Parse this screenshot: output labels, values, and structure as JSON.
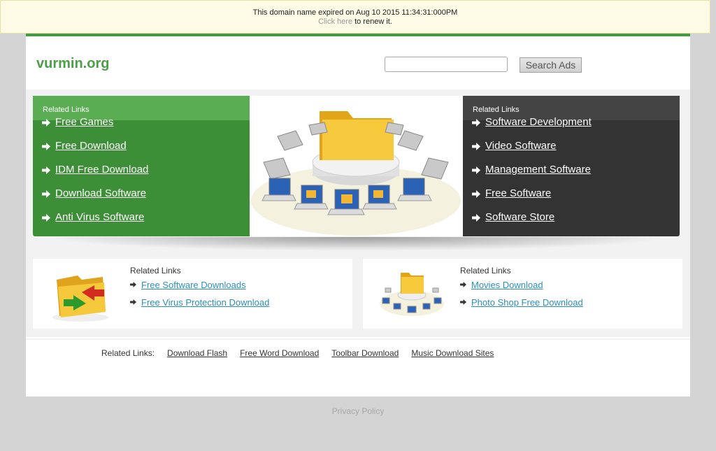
{
  "expiry": {
    "message": "This domain name expired on Aug 10 2015 11:34:31:000PM",
    "renew_link": "Click here",
    "renew_suffix": " to renew it."
  },
  "header": {
    "logo": "vurmin.org",
    "search_button": "Search Ads"
  },
  "panel_left": {
    "heading": "Related Links",
    "links": [
      "Free Games",
      "Free Download",
      "IDM Free Download",
      "Download Software",
      "Anti Virus Software"
    ]
  },
  "panel_right": {
    "heading": "Related Links",
    "links": [
      "Software Development",
      "Video Software",
      "Management Software",
      "Free Software",
      "Software Store"
    ]
  },
  "box_left": {
    "heading": "Related Links",
    "links": [
      "Free Software Downloads",
      "Free Virus Protection Download"
    ]
  },
  "box_right": {
    "heading": "Related Links",
    "links": [
      "Movies Download",
      "Photo Shop Free Download"
    ]
  },
  "footer": {
    "label": "Related Links:",
    "links": [
      "Download Flash",
      "Free Word Download",
      "Toolbar Download",
      "Music Download Sites"
    ]
  },
  "privacy": "Privacy Policy",
  "colors": {
    "brand_green": "#4c9f47",
    "panel_green": "#3d8f37",
    "panel_dark": "#333333",
    "link_blue": "#2a8fbd"
  },
  "icons": [
    "arrow-bullet-icon",
    "folder-network-image",
    "folder-sync-image"
  ]
}
